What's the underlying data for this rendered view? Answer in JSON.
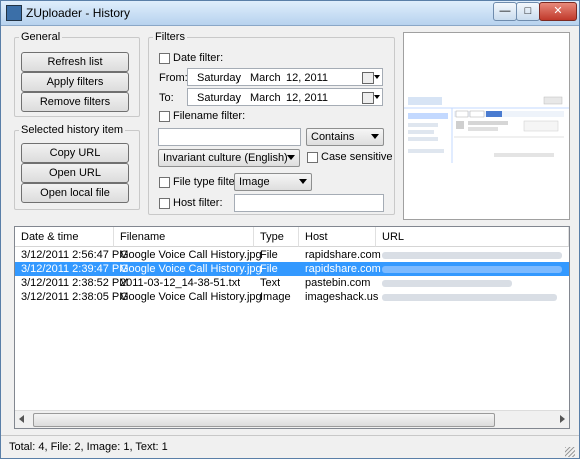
{
  "window": {
    "title": "ZUploader - History"
  },
  "general": {
    "title": "General",
    "refresh_label": "Refresh list",
    "apply_label": "Apply filters",
    "remove_label": "Remove filters"
  },
  "selected_item": {
    "title": "Selected history item",
    "copy_url_label": "Copy URL",
    "open_url_label": "Open URL",
    "open_local_label": "Open local file"
  },
  "filters": {
    "title": "Filters",
    "date_filter_label": "Date filter:",
    "from_label": "From:",
    "from_day": "Saturday",
    "from_month": "March",
    "from_date": "12, 2011",
    "to_label": "To:",
    "to_day": "Saturday",
    "to_month": "March",
    "to_date": "12, 2011",
    "separator": ",",
    "filename_filter_label": "Filename filter:",
    "filename_value": "",
    "match_mode": "Contains",
    "culture": "Invariant culture (English)",
    "case_sensitive_label": "Case sensitive",
    "file_type_filter_label": "File type filter:",
    "file_type_value": "Image",
    "host_filter_label": "Host filter:",
    "host_value": ""
  },
  "list": {
    "columns": [
      "Date & time",
      "Filename",
      "Type",
      "Host",
      "URL"
    ],
    "rows": [
      {
        "datetime": "3/12/2011 2:56:47 PM",
        "filename": "Google Voice Call History.jpg",
        "type": "File",
        "host": "rapidshare.com",
        "url": ""
      },
      {
        "datetime": "3/12/2011 2:39:47 PM",
        "filename": "Google Voice Call History.jpg",
        "type": "File",
        "host": "rapidshare.com",
        "url": ""
      },
      {
        "datetime": "3/12/2011 2:38:52 PM",
        "filename": "2011-03-12_14-38-51.txt",
        "type": "Text",
        "host": "pastebin.com",
        "url": ""
      },
      {
        "datetime": "3/12/2011 2:38:05 PM",
        "filename": "Google Voice Call History.jpg",
        "type": "Image",
        "host": "imageshack.us",
        "url": ""
      }
    ]
  },
  "status": {
    "text": "Total: 4, File: 2, Image: 1, Text: 1"
  },
  "colors": {
    "selection": "#3399ff",
    "title_bar": "#c9dff5"
  }
}
